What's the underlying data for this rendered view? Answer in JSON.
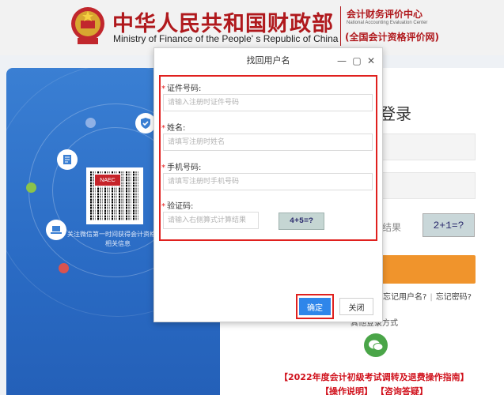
{
  "header": {
    "title_cn": "中华人民共和国财政部",
    "title_en": "Ministry of Finance of the People' s Republic of China",
    "center_cn": "会计财务评价中心",
    "center_en": "National Accounting Evaluation Center",
    "center_net": "(全国会计资格评价网)",
    "emblem_icon": "national-emblem-icon",
    "brand_color": "#b0191d"
  },
  "left_panel": {
    "qr_badge": "NAEC",
    "qr_caption": "关注微信第一时间获得会计资格考试相关信息",
    "icons": [
      "shield-check-icon",
      "document-icon",
      "laptop-icon"
    ]
  },
  "login": {
    "title": "登录",
    "captcha_result_label": "结果",
    "captcha_text": "2+1=?",
    "forgot_username": "忘记用户名?",
    "separator": "|",
    "forgot_password": "忘记密码?",
    "other_login": "其他登录方式",
    "accent_color": "#f0942c"
  },
  "notice": {
    "text": "【2022年度会计初级考试调转及退费操作指南】",
    "help": "【操作说明】",
    "faq": "【咨询答疑】"
  },
  "dialog": {
    "title": "找回用户名",
    "fields": [
      {
        "label": "证件号码:",
        "placeholder": "请输入注册时证件号码",
        "value": ""
      },
      {
        "label": "姓名:",
        "placeholder": "请填写注册时姓名",
        "value": ""
      },
      {
        "label": "手机号码:",
        "placeholder": "请填写注册时手机号码",
        "value": ""
      },
      {
        "label": "验证码:",
        "placeholder": "请输入右侧算式计算结果",
        "value": ""
      }
    ],
    "captcha_text": "4+5=?",
    "ok_label": "确定",
    "close_label": "关闭",
    "ok_color": "#2f86ea",
    "highlight_color": "#e0201e"
  }
}
